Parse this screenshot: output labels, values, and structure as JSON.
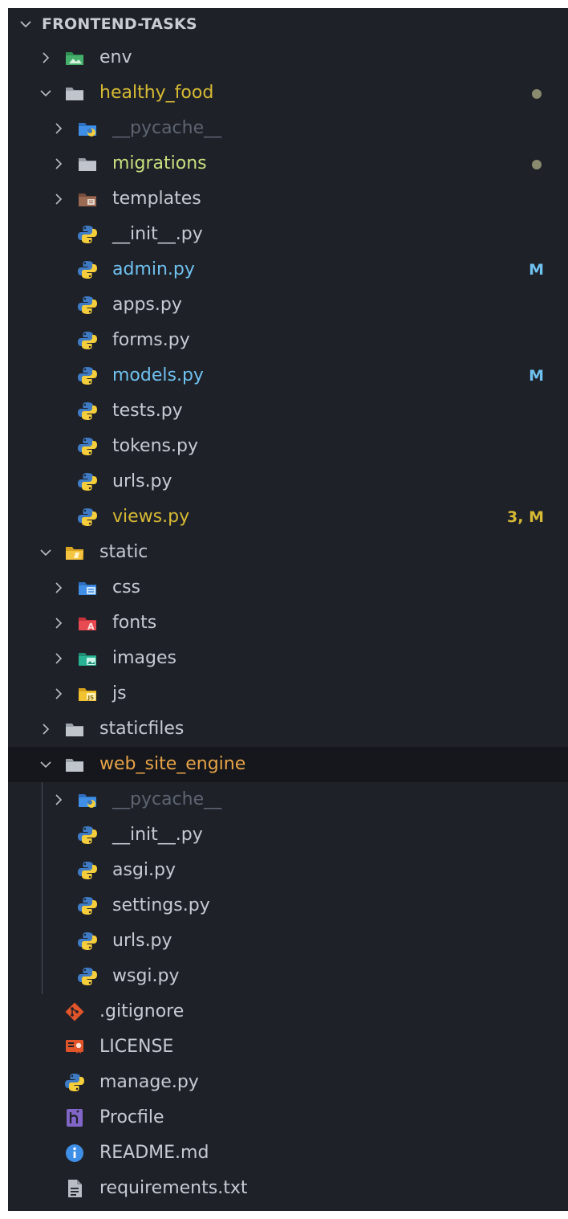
{
  "explorer": {
    "title": "FRONTEND-TASKS"
  },
  "colors": {
    "default_text": "#c6cbd3",
    "modified_text": "#6fc1f0",
    "warning_text": "#d7ba34",
    "untracked_text": "#c8e07e",
    "ignored_text": "#5d6470",
    "conflict_text": "#e8a347",
    "badge_modified": "#6fc1f0",
    "badge_warning": "#d7ba34",
    "dot_color": "#8a8a6e"
  },
  "rows": [
    {
      "label": "env",
      "icon": "env-folder-icon",
      "state": "collapsed",
      "status": "default"
    },
    {
      "label": "healthy_food",
      "icon": "folder-icon",
      "state": "expanded",
      "status": "warning",
      "dot": true
    },
    {
      "label": "__pycache__",
      "icon": "python-folder-icon",
      "state": "collapsed",
      "status": "ignored"
    },
    {
      "label": "migrations",
      "icon": "folder-icon",
      "state": "collapsed",
      "status": "untracked",
      "dot": true
    },
    {
      "label": "templates",
      "icon": "templates-folder-icon",
      "state": "collapsed",
      "status": "default"
    },
    {
      "label": "__init__.py",
      "icon": "python-icon",
      "status": "default"
    },
    {
      "label": "admin.py",
      "icon": "python-icon",
      "status": "modified",
      "badge": "M"
    },
    {
      "label": "apps.py",
      "icon": "python-icon",
      "status": "default"
    },
    {
      "label": "forms.py",
      "icon": "python-icon",
      "status": "default"
    },
    {
      "label": "models.py",
      "icon": "python-icon",
      "status": "modified",
      "badge": "M"
    },
    {
      "label": "tests.py",
      "icon": "python-icon",
      "status": "default"
    },
    {
      "label": "tokens.py",
      "icon": "python-icon",
      "status": "default"
    },
    {
      "label": "urls.py",
      "icon": "python-icon",
      "status": "default"
    },
    {
      "label": "views.py",
      "icon": "python-icon",
      "status": "warning",
      "badge": "3, M"
    },
    {
      "label": "static",
      "icon": "static-folder-icon",
      "state": "expanded",
      "status": "default"
    },
    {
      "label": "css",
      "icon": "css-folder-icon",
      "state": "collapsed",
      "status": "default"
    },
    {
      "label": "fonts",
      "icon": "fonts-folder-icon",
      "state": "collapsed",
      "status": "default"
    },
    {
      "label": "images",
      "icon": "images-folder-icon",
      "state": "collapsed",
      "status": "default"
    },
    {
      "label": "js",
      "icon": "js-folder-icon",
      "state": "collapsed",
      "status": "default"
    },
    {
      "label": "staticfiles",
      "icon": "folder-icon",
      "state": "collapsed",
      "status": "default"
    },
    {
      "label": "web_site_engine",
      "icon": "folder-icon",
      "state": "expanded",
      "status": "conflict",
      "selected": true
    },
    {
      "label": "__pycache__",
      "icon": "python-folder-icon",
      "state": "collapsed",
      "status": "ignored"
    },
    {
      "label": "__init__.py",
      "icon": "python-icon",
      "status": "default"
    },
    {
      "label": "asgi.py",
      "icon": "python-icon",
      "status": "default"
    },
    {
      "label": "settings.py",
      "icon": "python-icon",
      "status": "default"
    },
    {
      "label": "urls.py",
      "icon": "python-icon",
      "status": "default"
    },
    {
      "label": "wsgi.py",
      "icon": "python-icon",
      "status": "default"
    },
    {
      "label": ".gitignore",
      "icon": "git-icon",
      "status": "default"
    },
    {
      "label": "LICENSE",
      "icon": "license-icon",
      "status": "default"
    },
    {
      "label": "manage.py",
      "icon": "python-icon",
      "status": "default"
    },
    {
      "label": "Procfile",
      "icon": "heroku-icon",
      "status": "default"
    },
    {
      "label": "README.md",
      "icon": "info-icon",
      "status": "default"
    },
    {
      "label": "requirements.txt",
      "icon": "text-file-icon",
      "status": "default"
    }
  ]
}
